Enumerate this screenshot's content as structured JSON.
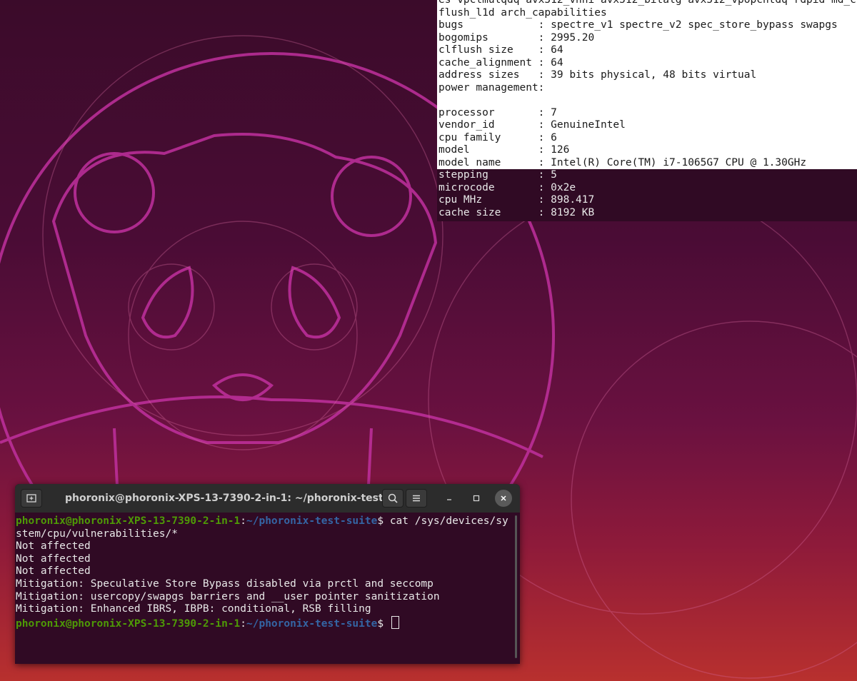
{
  "cpuinfo": {
    "clipped_lines": [
      "es vpclmulqdq avx512_vnni avx512_bitalg avx512_vpopcntdq rdpid md_c",
      "flush_l1d arch_capabilities"
    ],
    "selected_lines": [
      "bugs            : spectre_v1 spectre_v2 spec_store_bypass swapgs",
      "bogomips        : 2995.20",
      "clflush size    : 64",
      "cache_alignment : 64",
      "address sizes   : 39 bits physical, 48 bits virtual",
      "power management:",
      "",
      "processor       : 7",
      "vendor_id       : GenuineIntel",
      "cpu family      : 6",
      "model           : 126",
      "model name      : Intel(R) Core(TM) i7-1065G7 CPU @ 1.30GHz"
    ],
    "plain_lines": [
      "stepping        : 5",
      "microcode       : 0x2e",
      "cpu MHz         : 898.417",
      "cache size      : 8192 KB"
    ]
  },
  "terminal": {
    "title": "phoronix@phoronix-XPS-13-7390-2-in-1: ~/phoronix-test-suite",
    "prompt_user": "phoronix@phoronix-XPS-13-7390-2-in-1",
    "prompt_sep": ":",
    "prompt_path": "~/phoronix-test-suite",
    "prompt_end": "$ ",
    "command": "cat /sys/devices/sy",
    "command_wrap": "stem/cpu/vulnerabilities/*",
    "output": [
      "Not affected",
      "Not affected",
      "Not affected",
      "Mitigation: Speculative Store Bypass disabled via prctl and seccomp",
      "Mitigation: usercopy/swapgs barriers and __user pointer sanitization",
      "Mitigation: Enhanced IBRS, IBPB: conditional, RSB filling"
    ],
    "new_tab_icon": "new-tab-icon",
    "search_icon": "search-icon",
    "menu_icon": "hamburger-menu-icon",
    "minimize_icon": "minimize-icon",
    "maximize_icon": "maximize-icon",
    "close_icon": "close-icon"
  },
  "colors": {
    "terminal_bg": "#300a24",
    "prompt_user": "#4e9a06",
    "prompt_path": "#3465a4"
  }
}
